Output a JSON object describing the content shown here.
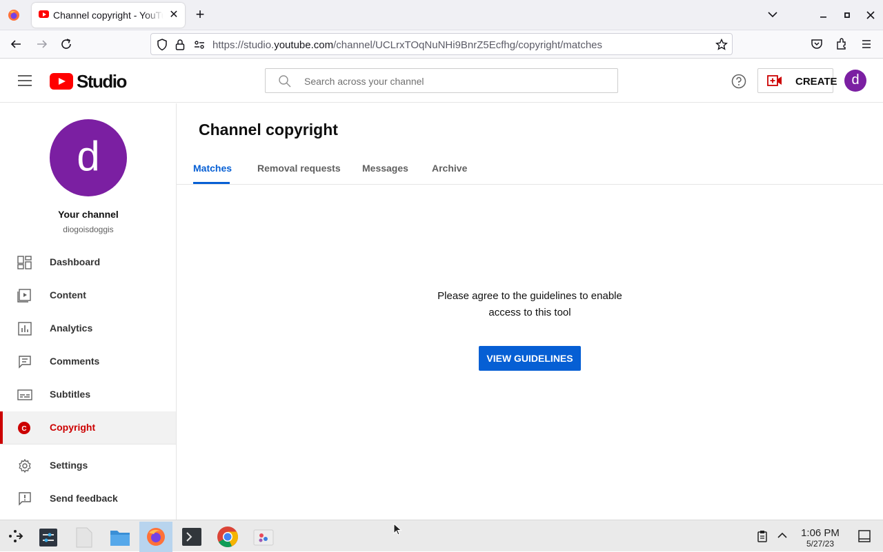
{
  "browser": {
    "tab_title": "Channel copyright - YouTube Studio",
    "tab_close": "✕",
    "new_tab": "+",
    "url_prefix": "https://studio.",
    "url_domain": "youtube.com",
    "url_path": "/channel/UCLrxTOqNuNHi9BnrZ5Ecfhg/copyright/matches"
  },
  "header": {
    "logo_text": "Studio",
    "search_placeholder": "Search across your channel",
    "create_label": "CREATE",
    "avatar_letter": "d"
  },
  "sidebar": {
    "avatar_letter": "d",
    "channel_name": "Your channel",
    "channel_handle": "diogoisdoggis",
    "items": [
      {
        "label": "Dashboard",
        "icon": "dashboard-icon"
      },
      {
        "label": "Content",
        "icon": "content-icon"
      },
      {
        "label": "Analytics",
        "icon": "analytics-icon"
      },
      {
        "label": "Comments",
        "icon": "comments-icon"
      },
      {
        "label": "Subtitles",
        "icon": "subtitles-icon"
      },
      {
        "label": "Copyright",
        "icon": "copyright-icon",
        "active": true
      },
      {
        "label": "Settings",
        "icon": "settings-icon"
      },
      {
        "label": "Send feedback",
        "icon": "feedback-icon"
      }
    ]
  },
  "main": {
    "title": "Channel copyright",
    "tabs": [
      {
        "label": "Matches",
        "active": true
      },
      {
        "label": "Removal requests"
      },
      {
        "label": "Messages"
      },
      {
        "label": "Archive"
      }
    ],
    "message": "Please agree to the guidelines to enable access to this tool",
    "button_label": "VIEW GUIDELINES"
  },
  "taskbar": {
    "time": "1:06 PM",
    "date": "5/27/23"
  },
  "colors": {
    "accent_blue": "#065fd4",
    "brand_red": "#ff0000",
    "active_red": "#cc0000",
    "avatar_purple": "#7b1fa2"
  }
}
